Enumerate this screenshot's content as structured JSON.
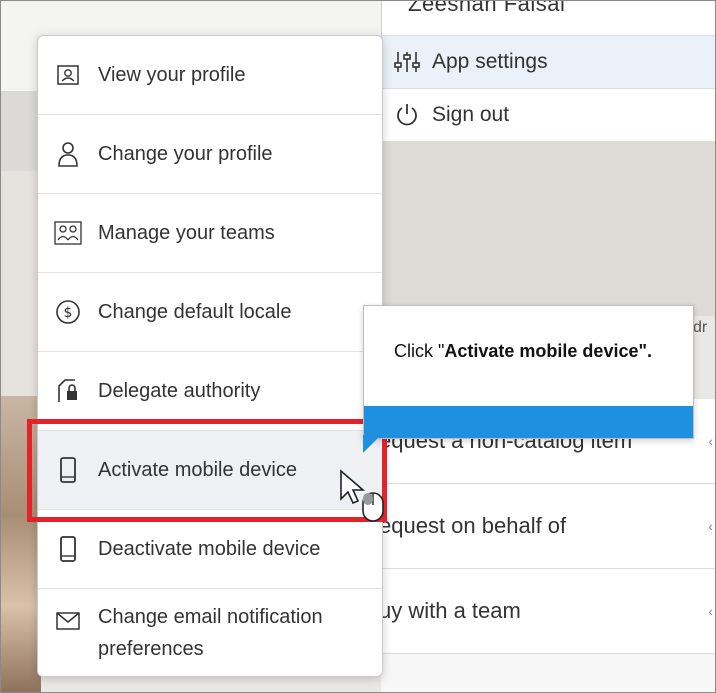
{
  "user_menu": {
    "name": "Zeeshan Faisal",
    "items": [
      {
        "label": "App settings",
        "icon": "sliders-icon"
      },
      {
        "label": "Sign out",
        "icon": "power-icon"
      }
    ]
  },
  "right_list": {
    "peek_label": "dr",
    "rows": [
      {
        "label": "equest a non-catalog item",
        "trail": "‹"
      },
      {
        "label": "equest on behalf of",
        "trail": "‹"
      },
      {
        "label": "uy with a team",
        "trail": "‹"
      }
    ]
  },
  "menu": {
    "items": [
      {
        "label": "View your profile",
        "icon": "profile-card-icon"
      },
      {
        "label": "Change your profile",
        "icon": "person-icon"
      },
      {
        "label": "Manage your teams",
        "icon": "team-icon"
      },
      {
        "label": "Change default locale",
        "icon": "dollar-circle-icon"
      },
      {
        "label": "Delegate authority",
        "icon": "lock-document-icon"
      },
      {
        "label": "Activate mobile device",
        "icon": "mobile-device-icon"
      },
      {
        "label": "Deactivate mobile device",
        "icon": "mobile-device-icon"
      },
      {
        "label": "Change email notification",
        "label2": "preferences",
        "icon": "envelope-icon"
      }
    ]
  },
  "tooltip": {
    "prefix": "Click \"",
    "bold": "Activate mobile device\"."
  },
  "colors": {
    "highlight_border": "#e5222a",
    "tooltip_bar": "#1f8fe0"
  }
}
